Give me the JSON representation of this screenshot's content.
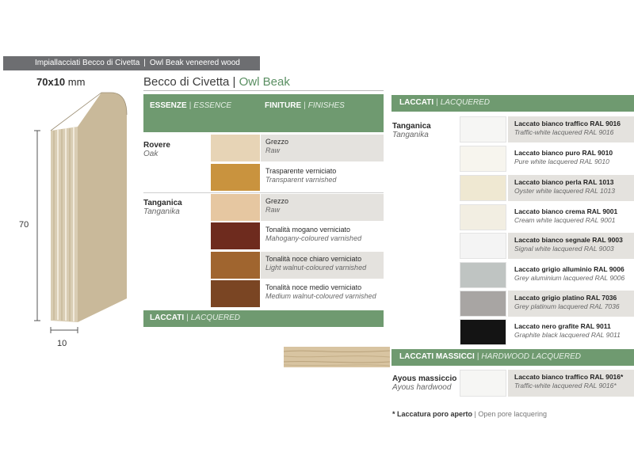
{
  "header": {
    "it": "Impiallacciati Becco di Civetta",
    "en": "Owl Beak veneered wood"
  },
  "profile": {
    "size": "70x10",
    "unit": "mm",
    "dim_height": "70",
    "dim_width": "10"
  },
  "title": {
    "it": "Becco di Civetta",
    "en": "Owl Beak"
  },
  "left_header": {
    "essenze": "ESSENZE",
    "essence": "ESSENCE",
    "finiture": "FINITURE",
    "finishes": "FINISHES"
  },
  "essences": [
    {
      "it": "Rovere",
      "en": "Oak",
      "finishes": [
        {
          "it": "Grezzo",
          "en": "Raw",
          "color": "#e7d4b6"
        },
        {
          "it": "Trasparente verniciato",
          "en": "Transparent varnished",
          "color": "#c9933e"
        }
      ]
    },
    {
      "it": "Tanganica",
      "en": "Tanganika",
      "finishes": [
        {
          "it": "Grezzo",
          "en": "Raw",
          "color": "#e6c7a1"
        },
        {
          "it": "Tonalità mogano verniciato",
          "en": "Mahogany-coloured varnished",
          "color": "#6e2b1e"
        },
        {
          "it": "Tonalità noce chiaro verniciato",
          "en": "Light walnut-coloured varnished",
          "color": "#a0652f"
        },
        {
          "it": "Tonalità noce medio verniciato",
          "en": "Medium walnut-coloured varnished",
          "color": "#7a4523"
        }
      ]
    }
  ],
  "laccati_left": {
    "it": "LACCATI",
    "en": "LACQUERED"
  },
  "laccati_right": {
    "it": "LACCATI",
    "en": "LACQUERED"
  },
  "tanganica_label": {
    "it": "Tanganica",
    "en": "Tanganika"
  },
  "lacquers": [
    {
      "it": "Laccato bianco traffico RAL 9016",
      "en": "Traffic-white lacquered RAL 9016",
      "color": "#f6f6f4"
    },
    {
      "it": "Laccato bianco puro RAL 9010",
      "en": "Pure white lacquered RAL 9010",
      "color": "#f7f5ee"
    },
    {
      "it": "Laccato bianco perla RAL 1013",
      "en": "Oyster white lacquered RAL 1013",
      "color": "#efe8d2"
    },
    {
      "it": "Laccato bianco crema RAL 9001",
      "en": "Cream white lacquered RAL 9001",
      "color": "#f2eee2"
    },
    {
      "it": "Laccato bianco segnale RAL 9003",
      "en": "Signal white lacquered RAL 9003",
      "color": "#f4f4f4"
    },
    {
      "it": "Laccato grigio alluminio RAL 9006",
      "en": "Grey aluminium lacquered RAL 9006",
      "color": "#bfc4c2"
    },
    {
      "it": "Laccato grigio platino RAL 7036",
      "en": "Grey platinum lacquered RAL 7036",
      "color": "#a8a5a3"
    },
    {
      "it": "Laccato nero grafite RAL 9011",
      "en": "Graphite black lacquered RAL 9011",
      "color": "#141414"
    }
  ],
  "massicci": {
    "it": "LACCATI MASSICCI",
    "en": "HARDWOOD LACQUERED"
  },
  "ayous": {
    "it": "Ayous massiccio",
    "en": "Ayous hardwood",
    "finish_it": "Laccato bianco traffico RAL 9016*",
    "finish_en": "Traffic-white lacquered RAL 9016*",
    "color": "#f6f6f4"
  },
  "note": {
    "it": "* Laccatura poro aperto",
    "en": "Open pore lacquering"
  }
}
